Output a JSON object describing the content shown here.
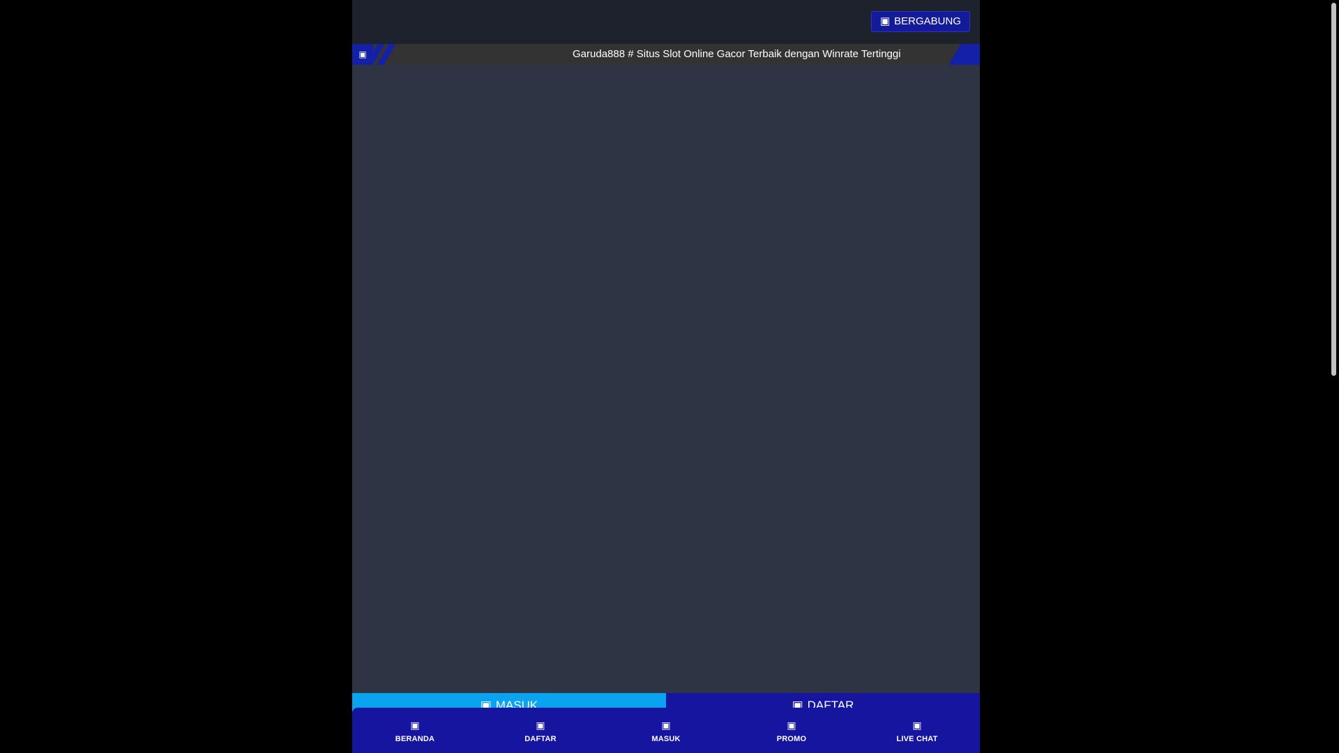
{
  "header": {
    "join_button_label": "BERGABUNG",
    "join_button_icon": "user-plus-icon"
  },
  "ticker": {
    "lead_icon": "megaphone-icon",
    "message": "Garuda888 # Situs Slot Online Gacor Terbaik dengan Winrate Tertinggi"
  },
  "cta": {
    "login_label": "MASUK",
    "register_label": "DAFTAR"
  },
  "bottom_nav": {
    "items": [
      {
        "label": "BERANDA",
        "icon": "home-icon"
      },
      {
        "label": "DAFTAR",
        "icon": "user-plus-icon"
      },
      {
        "label": "MASUK",
        "icon": "sign-in-icon"
      },
      {
        "label": "PROMO",
        "icon": "gift-icon"
      },
      {
        "label": "LIVE CHAT",
        "icon": "chat-icon"
      }
    ]
  },
  "colors": {
    "page_bg": "#000000",
    "content_bg": "#2e3443",
    "header_bg": "#1d222c",
    "brand_blue": "#1515a0",
    "login_cyan": "#0aa3ef"
  }
}
